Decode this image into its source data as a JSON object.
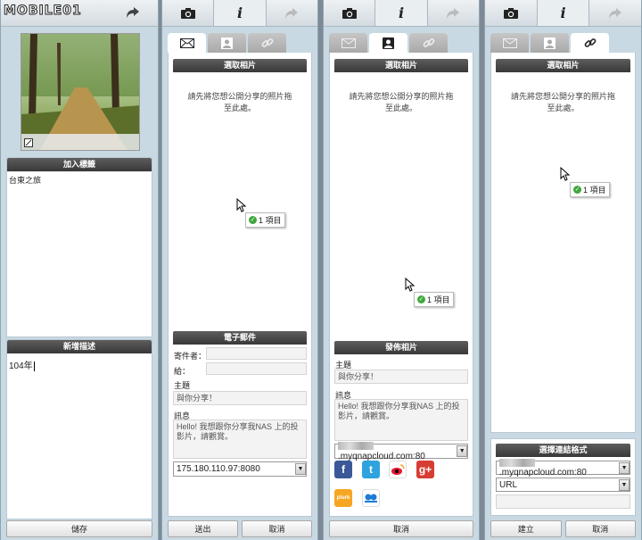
{
  "p1": {
    "logo": "MOBILE01",
    "tag_header": "加入標籤",
    "tag_value": "台東之旅",
    "desc_header": "新增描述",
    "desc_value": "104年",
    "save": "儲存"
  },
  "p2": {
    "select_header": "選取相片",
    "drop_hint": "請先將您想公開分享的照片拖至此處。",
    "badge": "1 項目",
    "email_header": "電子郵件",
    "sender_label": "寄件者：",
    "to_label": "給：",
    "subject_label": "主題",
    "subject_value": "與你分享！",
    "message_label": "訊息",
    "message_value": "Hello! 我想跟你分享我NAS 上的投影片，請觀賞。",
    "server_value": "175.180.110.97:8080",
    "send": "送出",
    "cancel": "取消"
  },
  "p3": {
    "select_header": "選取相片",
    "drop_hint": "請先將您想公開分享的照片拖至此處。",
    "badge": "1 項目",
    "publish_header": "發佈相片",
    "subject_label": "主題",
    "subject_value": "與你分享！",
    "message_label": "訊息",
    "message_value": "Hello! 我想跟你分享我NAS 上的投影片，請觀賞。",
    "domain_value": ".myqnapcloud.com:80",
    "cancel": "取消"
  },
  "p4": {
    "select_header": "選取相片",
    "drop_hint": "請先將您想公開分享的照片拖至此處。",
    "badge": "1 項目",
    "link_format_header": "選擇連結格式",
    "domain_value": ".myqnapcloud.com:80",
    "format_value": "URL",
    "create": "建立",
    "cancel": "取消"
  },
  "icons": [
    "camera-icon",
    "info-icon",
    "share-icon",
    "mail-icon",
    "contact-icon",
    "link-icon"
  ],
  "social": [
    "facebook",
    "twitter",
    "weibo",
    "google-plus",
    "plurk",
    "qzone"
  ]
}
